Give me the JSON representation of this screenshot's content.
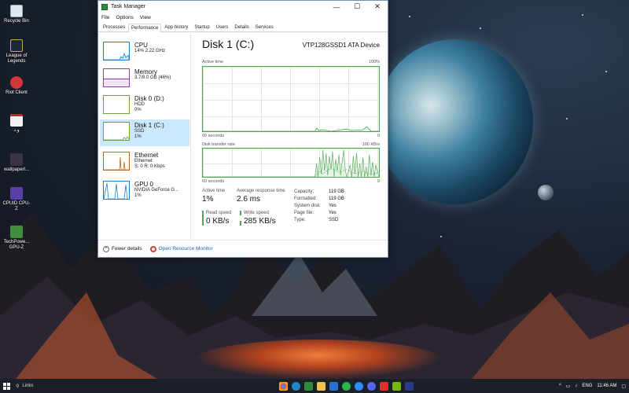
{
  "desktop": {
    "icons": [
      {
        "label": "Recycle Bin"
      },
      {
        "label": "League of Legends"
      },
      {
        "label": "Riot Client"
      },
      {
        "label": "و.د"
      },
      {
        "label": "wallpaperl..."
      },
      {
        "label": "CPUID CPU-Z"
      },
      {
        "label": "TechPowe... GPU-Z"
      }
    ]
  },
  "window": {
    "title": "Task Manager",
    "controls": {
      "minimize": "—",
      "maximize": "☐",
      "close": "✕"
    },
    "menu": [
      "File",
      "Options",
      "View"
    ],
    "tabs": [
      "Processes",
      "Performance",
      "App history",
      "Startup",
      "Users",
      "Details",
      "Services"
    ],
    "active_tab": "Performance"
  },
  "resources": [
    {
      "name": "CPU",
      "sub1": "14% 2.22 GHz",
      "sub2": ""
    },
    {
      "name": "Memory",
      "sub1": "3.7/8.0 GB (46%)",
      "sub2": ""
    },
    {
      "name": "Disk 0 (D:)",
      "sub1": "HDD",
      "sub2": "0%"
    },
    {
      "name": "Disk 1 (C:)",
      "sub1": "SSD",
      "sub2": "1%"
    },
    {
      "name": "Ethernet",
      "sub1": "Ethernet",
      "sub2": "S: 0 R: 0 Kbps"
    },
    {
      "name": "GPU 0",
      "sub1": "NVIDIA GeForce G...",
      "sub2": "1%"
    }
  ],
  "detail": {
    "title": "Disk 1 (C:)",
    "model": "VTP128GSSD1 ATA Device",
    "graph1": {
      "label": "Active time",
      "max": "100%",
      "xleft": "60 seconds",
      "xright": "0"
    },
    "graph2": {
      "label": "Disk transfer rate",
      "max": "100 KB/s",
      "xleft": "60 seconds",
      "xright": "0"
    },
    "stats": {
      "active_time_label": "Active time",
      "active_time": "1%",
      "resp_label": "Average response time",
      "resp": "2.6 ms",
      "read_label": "Read speed",
      "read": "0 KB/s",
      "write_label": "Write speed",
      "write": "285 KB/s"
    },
    "props": [
      {
        "k": "Capacity:",
        "v": "119 GB"
      },
      {
        "k": "Formatted:",
        "v": "119 GB"
      },
      {
        "k": "System disk:",
        "v": "Yes"
      },
      {
        "k": "Page file:",
        "v": "Yes"
      },
      {
        "k": "Type:",
        "v": "SSD"
      }
    ]
  },
  "footer": {
    "fewer": "Fewer details",
    "monitor": "Open Resource Monitor"
  },
  "taskbar": {
    "search": "Links",
    "lang": "ENG",
    "time": "11:46 AM"
  }
}
